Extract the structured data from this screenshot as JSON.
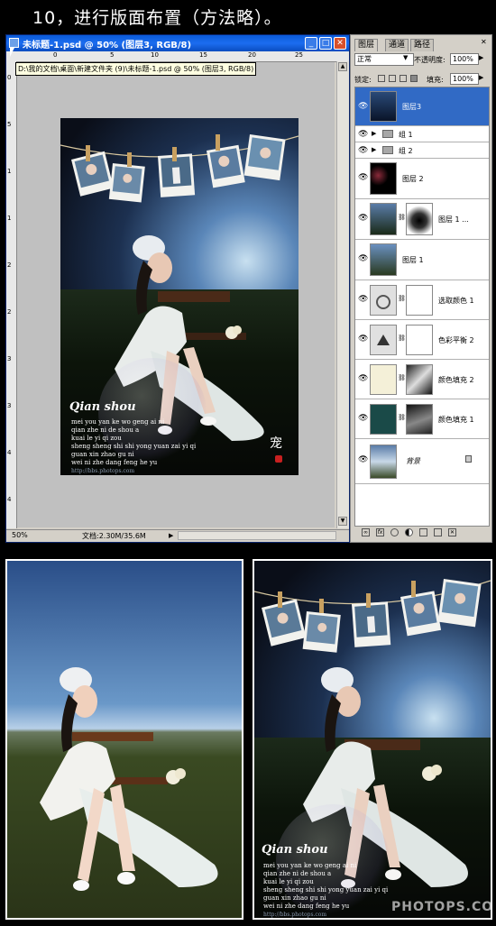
{
  "heading": "10，进行版面布置（方法略）。",
  "window": {
    "title": "未标题-1.psd @ 50% (图层3, RGB/8)",
    "path_tooltip": "D:\\我的文档\\桌面\\新建文件夹 (9)\\未标题-1.psd @ 50% (图层3, RGB/8)",
    "ruler_top_ticks": [
      "0",
      "5",
      "10",
      "15",
      "20",
      "25"
    ],
    "ruler_left_ticks": [
      "0",
      "5",
      "1",
      "1",
      "2",
      "2",
      "3",
      "3",
      "4",
      "4"
    ],
    "zoom": "50%",
    "doc_size": "文档:2.30M/35.6M"
  },
  "artwork": {
    "title_script": "Qian shou",
    "lyrics": [
      "mei you yan ke wo geng ai ni",
      "qian zhe ni de shou a",
      "kuai le yi qi zou",
      "sheng sheng shi shi yong yuan zai yi qi",
      "guan xin zhao gu ni",
      "wei ni zhe dang feng he yu"
    ],
    "url": "http://bbs.photops.com",
    "stamp": "宠"
  },
  "layers_panel": {
    "tabs": [
      "图层",
      "通道",
      "路径"
    ],
    "blend_mode": "正常",
    "opacity_label": "不透明度:",
    "opacity_value": "100%",
    "lock_label": "锁定:",
    "fill_label": "填充:",
    "fill_value": "100%",
    "layers": [
      {
        "name": "图层3",
        "selected": true
      },
      {
        "name": "组 1"
      },
      {
        "name": "组 2"
      },
      {
        "name": "图层 2"
      },
      {
        "name": "图层 1 ..."
      },
      {
        "name": "图层 1"
      },
      {
        "name": "选取颜色 1"
      },
      {
        "name": "色彩平衡 2"
      },
      {
        "name": "颜色填充 2"
      },
      {
        "name": "颜色填充 1"
      },
      {
        "name": "背景"
      }
    ]
  },
  "bottom": {
    "watermark": "PHOTOPS.COM"
  },
  "colors": {
    "title_bar": "#1c6df0",
    "selected_layer": "#316ac5",
    "fill1_swatch": "#1a4a48",
    "fill2_swatch": "#f4f0d8"
  }
}
